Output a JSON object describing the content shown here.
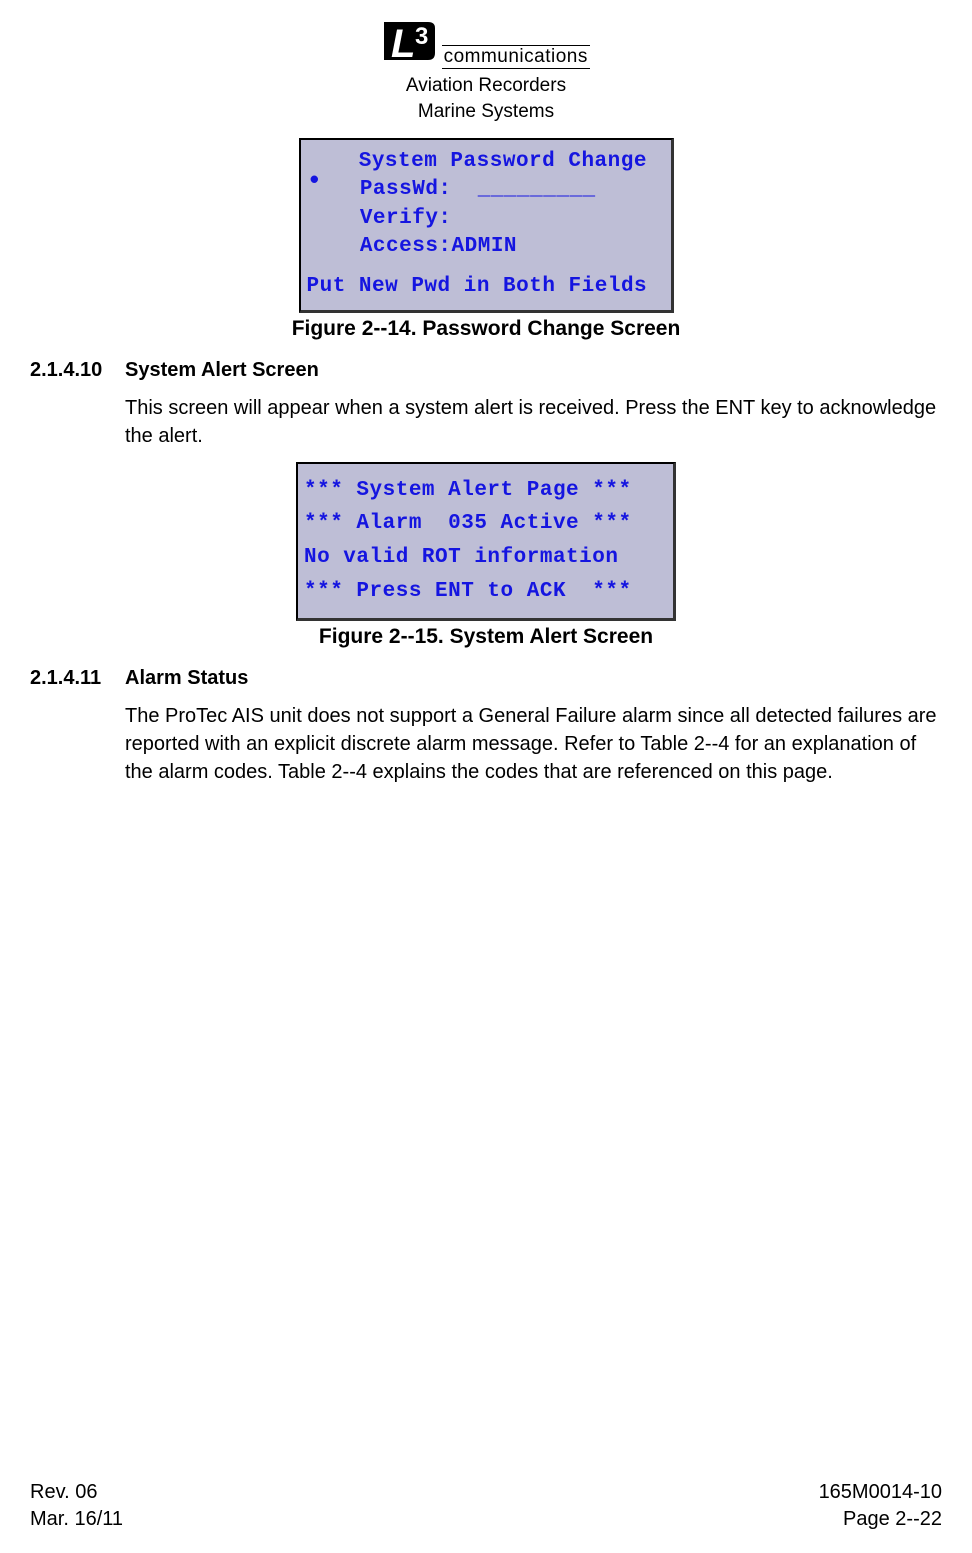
{
  "header": {
    "logo_l": "L",
    "logo_3": "3",
    "communications": "communications",
    "line1": "Aviation Recorders",
    "line2": "Marine Systems"
  },
  "screen1": {
    "title": "System Password Change",
    "row1": "PassWd:  _________",
    "row2": "Verify:",
    "row3": "Access:ADMIN",
    "footer": "Put New Pwd in Both Fields"
  },
  "fig1_caption": "Figure 2--14.  Password Change Screen",
  "sec1": {
    "num": "2.1.4.10",
    "title": "System Alert Screen",
    "body": "This screen will appear when a system alert is received. Press the ENT key to acknowledge the alert."
  },
  "screen2": {
    "l1": "*** System Alert Page ***",
    "l2": "*** Alarm  035 Active ***",
    "l3": "No valid ROT information",
    "l4": "*** Press ENT to ACK  ***"
  },
  "fig2_caption": "Figure 2--15.  System Alert Screen",
  "sec2": {
    "num": "2.1.4.11",
    "title": "Alarm Status",
    "body": "The ProTec AIS unit does not support a General Failure alarm since all detected failures are reported with an explicit discrete alarm message. Refer to Table 2--4 for an explanation of the alarm codes. Table 2--4 explains the codes that are referenced on this page."
  },
  "footer": {
    "rev": "Rev. 06",
    "date": "Mar. 16/11",
    "docnum": "165M0014-10",
    "page": "Page 2--22"
  }
}
